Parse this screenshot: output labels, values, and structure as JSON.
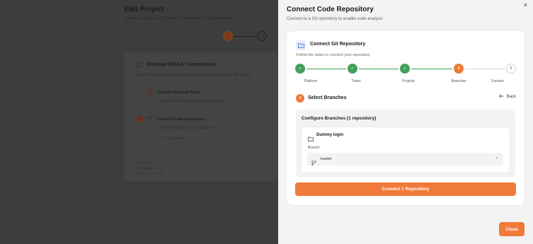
{
  "background": {
    "title": "Edit Project",
    "subtitle": "Update your project with AI-powered capabilities and data integrations",
    "card_title": "External Data & Connections",
    "card_subtitle": "Select the types of data and connections you want to integrate with your p",
    "option1_title": "Connect External Tools",
    "option1_sub": "Connect to Jira, Azure DevOps, Figma, and more",
    "option2_title": "Connect Code Repository",
    "option2_sub": "Connect to GitHub, GitLab, or Bitbucket",
    "option2_code_icon": "</>",
    "connect_label": "< / >  Connect",
    "back_label": "Back",
    "step_active_number": "2",
    "step_next_number": "3"
  },
  "drawer": {
    "title": "Connect Code Repository",
    "subtitle": "Connect to a Git repository to enable code analysis",
    "close_icon": "×",
    "card": {
      "title": "Connect Git Repository",
      "subtitle": "Follow the steps to connect your repository",
      "steps": [
        {
          "label": "Platform",
          "state": "done",
          "mark": "✓"
        },
        {
          "label": "Token",
          "state": "done",
          "mark": "✓"
        },
        {
          "label": "Projects",
          "state": "done",
          "mark": "✓"
        },
        {
          "label": "Branches",
          "state": "active",
          "mark": "4"
        },
        {
          "label": "Connect",
          "state": "todo",
          "mark": "5"
        }
      ],
      "section_number": "4",
      "section_title": "Select Branches",
      "back_label": "Back",
      "config_title": "Configure Branches (1 repository)",
      "repo_name": "Dummy login",
      "branch_label": "Branch:",
      "branch_value": "master",
      "connect_button": "Connect 1 Repository"
    },
    "close_button": "Close"
  },
  "colors": {
    "accent": "#f07a3a",
    "success": "#43a05a"
  }
}
